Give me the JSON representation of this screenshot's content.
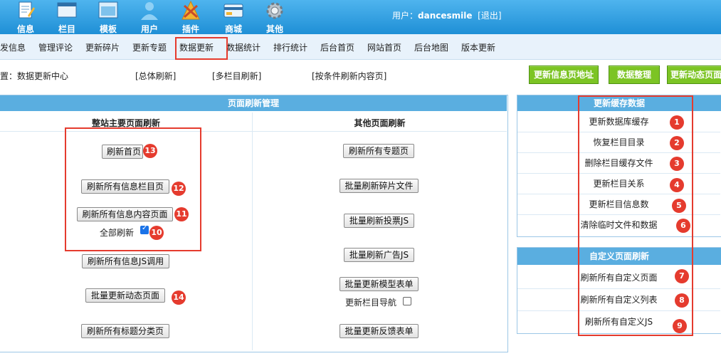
{
  "toolbar": {
    "items": [
      {
        "label": "信息",
        "icon": "document-edit-icon"
      },
      {
        "label": "栏目",
        "icon": "folder-window-icon"
      },
      {
        "label": "模板",
        "icon": "template-window-icon"
      },
      {
        "label": "用户",
        "icon": "user-icon"
      },
      {
        "label": "插件",
        "icon": "plugin-tools-icon"
      },
      {
        "label": "商城",
        "icon": "shop-card-icon"
      },
      {
        "label": "其他",
        "icon": "gear-icon"
      }
    ],
    "user_label": "用户：",
    "username": "dancesmile",
    "logout": "[退出]"
  },
  "menu": {
    "items": [
      "发信息",
      "管理评论",
      "更新碎片",
      "更新专题",
      "数据更新",
      "数据统计",
      "排行统计",
      "后台首页",
      "网站首页",
      "后台地图",
      "版本更新"
    ],
    "active_index": 4
  },
  "breadcrumb": {
    "location": "置：数据更新中心",
    "links": [
      "[总体刷新]",
      "[多栏目刷新]",
      "[按条件刷新内容页]"
    ]
  },
  "actions": [
    "更新信息页地址",
    "数据整理",
    "更新动态页面"
  ],
  "refresh_panel": {
    "title": "页面刷新管理",
    "left_title": "整站主要页面刷新",
    "right_title": "其他页面刷新",
    "left_buttons": [
      "刷新首页",
      "刷新所有信息栏目页",
      "刷新所有信息内容页面",
      "刷新所有信息JS调用",
      "批量更新动态页面",
      "刷新所有标题分类页"
    ],
    "full_refresh_label": "全部刷新",
    "full_refresh_checked": true,
    "right_buttons": [
      "刷新所有专题页",
      "批量刷新碎片文件",
      "批量刷新投票JS",
      "批量刷新广告JS",
      "批量更新模型表单",
      "批量更新反馈表单"
    ],
    "nav_label": "更新栏目导航",
    "nav_checked": false
  },
  "cache_panel": {
    "title": "更新缓存数据",
    "items": [
      "更新数据库缓存",
      "恢复栏目目录",
      "删除栏目缓存文件",
      "更新栏目关系",
      "更新栏目信息数",
      "清除临时文件和数据"
    ]
  },
  "custom_panel": {
    "title": "自定义页面刷新",
    "items": [
      "刷新所有自定义页面",
      "刷新所有自定义列表",
      "刷新所有自定义JS"
    ]
  },
  "badges": [
    "1",
    "2",
    "3",
    "4",
    "5",
    "6",
    "7",
    "8",
    "9",
    "10",
    "11",
    "12",
    "13",
    "14"
  ],
  "colors": {
    "accent": "#2a93da",
    "highlight": "#e53b2e",
    "action_green": "#7cc424"
  }
}
